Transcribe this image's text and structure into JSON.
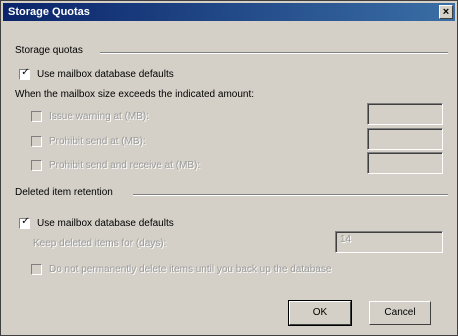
{
  "window": {
    "title": "Storage Quotas",
    "close_glyph": "×"
  },
  "storage_quotas": {
    "heading": "Storage quotas",
    "use_defaults_label": "Use mailbox database defaults",
    "use_defaults_checked": true,
    "exceeds_label": "When the mailbox size exceeds the indicated amount:",
    "items": [
      {
        "label": "Issue warning at (MB):",
        "checked": false,
        "enabled": false,
        "value": ""
      },
      {
        "label": "Prohibit send at (MB):",
        "checked": false,
        "enabled": false,
        "value": ""
      },
      {
        "label": "Prohibit send and receive at (MB):",
        "checked": false,
        "enabled": false,
        "value": ""
      }
    ]
  },
  "deleted_item_retention": {
    "heading": "Deleted item retention",
    "use_defaults_label": "Use mailbox database defaults",
    "use_defaults_checked": true,
    "keep_deleted_label": "Keep deleted items for (days):",
    "keep_deleted_value": "14",
    "dont_delete_label": "Do not permanently delete items until you back up the database"
  },
  "buttons": {
    "ok": "OK",
    "cancel": "Cancel"
  },
  "colors": {
    "titlebar_start": "#0a246a",
    "titlebar_end": "#3a6ea5",
    "face": "#d4d0c8"
  }
}
